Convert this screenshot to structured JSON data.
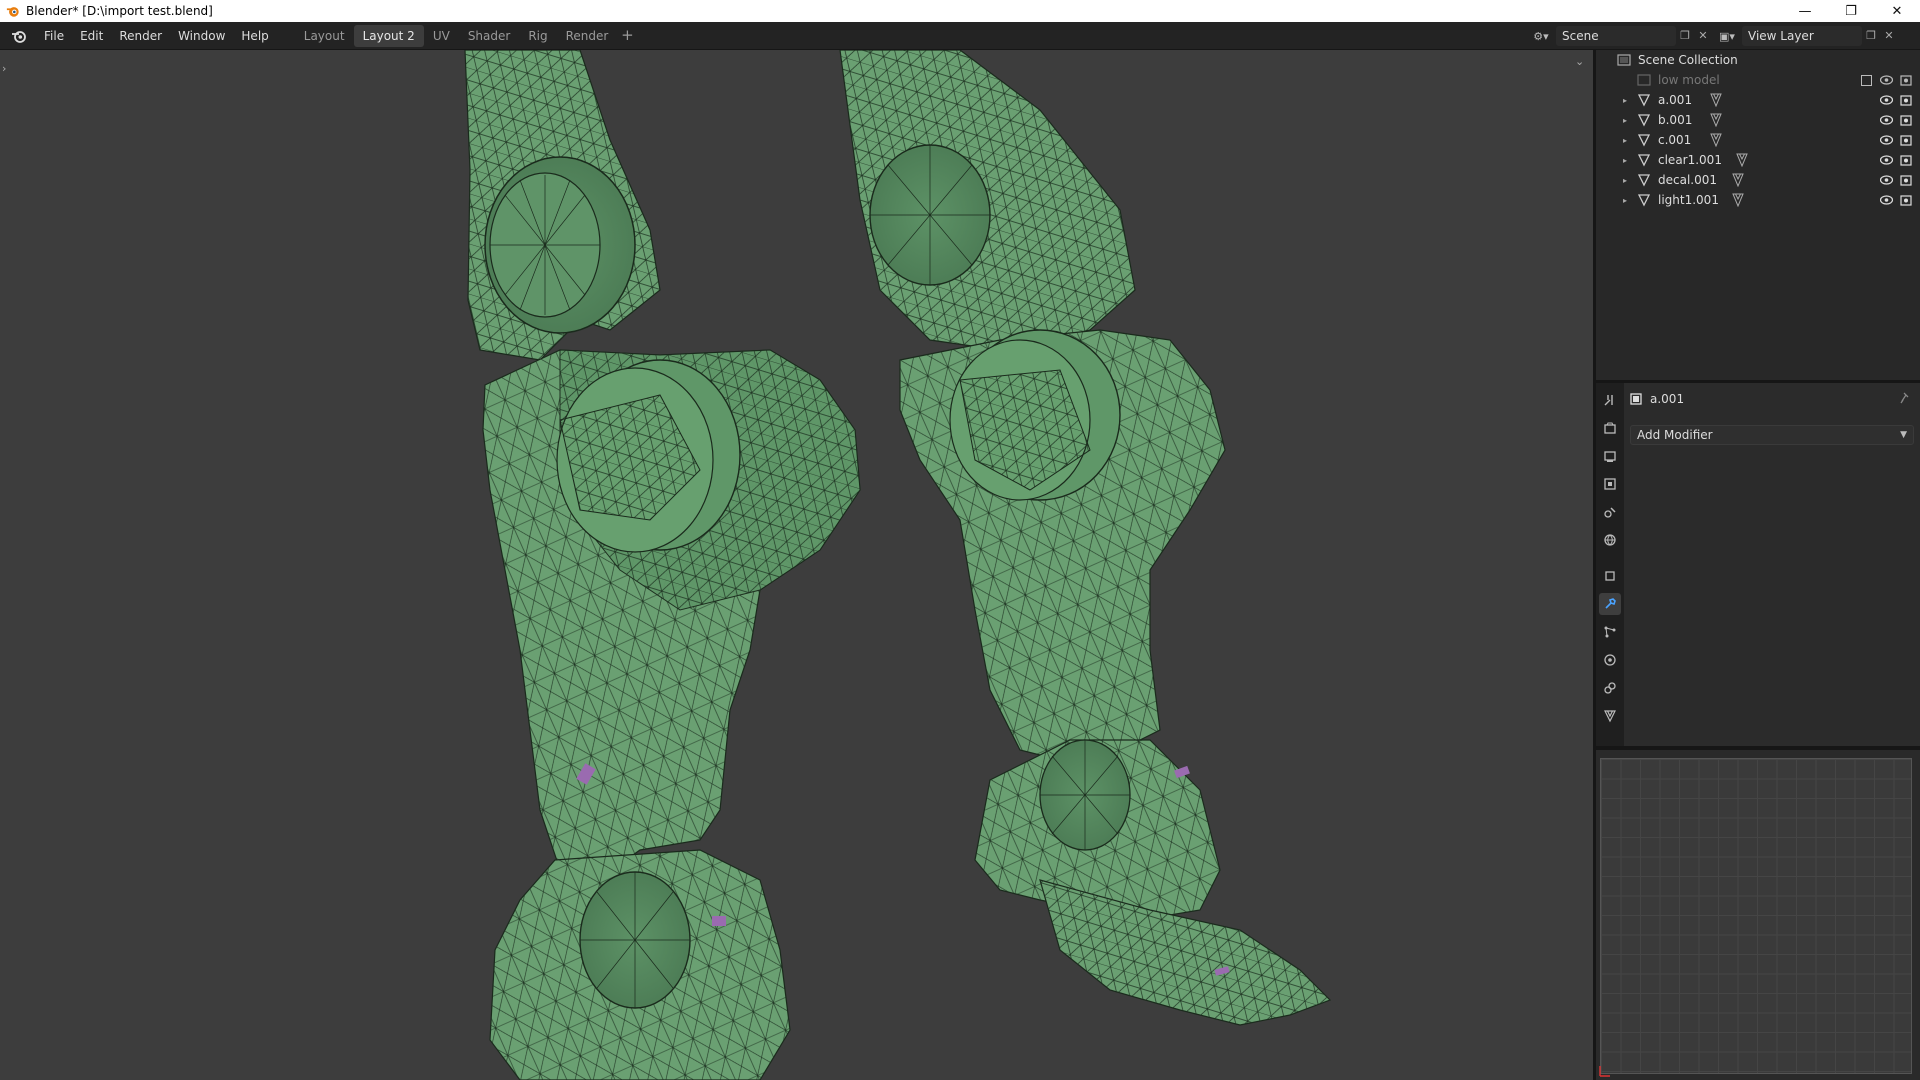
{
  "window": {
    "title": "Blender* [D:\\import test.blend]",
    "controls": [
      "minimize-icon",
      "restore-icon",
      "close-icon"
    ]
  },
  "menu": {
    "items": [
      "File",
      "Edit",
      "Render",
      "Window",
      "Help"
    ]
  },
  "workspaces": {
    "tabs": [
      "Layout",
      "Layout 2",
      "UV",
      "Shader",
      "Rig",
      "Render"
    ],
    "active": "Layout 2",
    "add_label": "+"
  },
  "scene": {
    "name": "Scene"
  },
  "view_layer": {
    "name": "View Layer"
  },
  "outliner": {
    "root": "Scene Collection",
    "items": [
      {
        "label": "low model",
        "dim": true
      },
      {
        "label": "a.001"
      },
      {
        "label": "b.001"
      },
      {
        "label": "c.001"
      },
      {
        "label": "clear1.001"
      },
      {
        "label": "decal.001"
      },
      {
        "label": "light1.001"
      }
    ]
  },
  "properties": {
    "object_name": "a.001",
    "add_modifier_label": "Add Modifier",
    "active_tab": "modifier-tab"
  },
  "colors": {
    "mesh_fill": "#6aa072",
    "mesh_wire": "#1a2a1c",
    "viewport_bg": "#3d3d3d",
    "active_tab_bg": "#3d3d3d"
  }
}
